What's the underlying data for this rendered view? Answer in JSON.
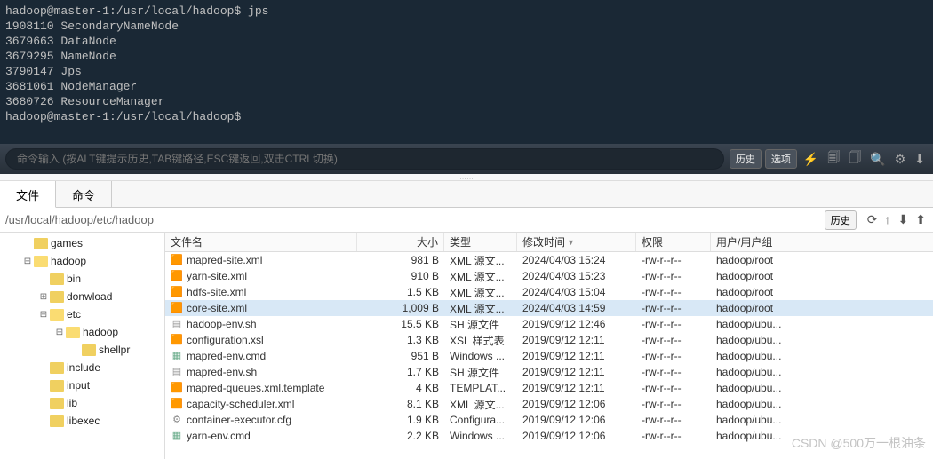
{
  "terminal": {
    "lines": [
      "hadoop@master-1:/usr/local/hadoop$ jps",
      "1908110 SecondaryNameNode",
      "3679663 DataNode",
      "3679295 NameNode",
      "3790147 Jps",
      "3681061 NodeManager",
      "3680726 ResourceManager",
      "hadoop@master-1:/usr/local/hadoop$"
    ]
  },
  "input_bar": {
    "placeholder": "命令输入 (按ALT键提示历史,TAB键路径,ESC键返回,双击CTRL切换)",
    "history_btn": "历史",
    "options_btn": "选项"
  },
  "tabs": {
    "file": "文件",
    "cmd": "命令"
  },
  "path": {
    "value": "/usr/local/hadoop/etc/hadoop",
    "history_btn": "历史"
  },
  "tree": [
    {
      "level": 1,
      "exp": "",
      "open": false,
      "label": "games"
    },
    {
      "level": 1,
      "exp": "⊟",
      "open": true,
      "label": "hadoop"
    },
    {
      "level": 2,
      "exp": "",
      "open": false,
      "label": "bin"
    },
    {
      "level": 2,
      "exp": "⊞",
      "open": false,
      "label": "donwload"
    },
    {
      "level": 2,
      "exp": "⊟",
      "open": true,
      "label": "etc"
    },
    {
      "level": 3,
      "exp": "⊟",
      "open": true,
      "label": "hadoop"
    },
    {
      "level": 4,
      "exp": "",
      "open": false,
      "label": "shellpr"
    },
    {
      "level": 2,
      "exp": "",
      "open": false,
      "label": "include"
    },
    {
      "level": 2,
      "exp": "",
      "open": false,
      "label": "input"
    },
    {
      "level": 2,
      "exp": "",
      "open": false,
      "label": "lib"
    },
    {
      "level": 2,
      "exp": "",
      "open": false,
      "label": "libexec"
    }
  ],
  "columns": {
    "name": "文件名",
    "size": "大小",
    "type": "类型",
    "mtime": "修改时间",
    "perm": "权限",
    "owner": "用户/用户组"
  },
  "files": [
    {
      "icon": "xml",
      "name": "mapred-site.xml",
      "size": "981 B",
      "type": "XML 源文...",
      "mtime": "2024/04/03 15:24",
      "perm": "-rw-r--r--",
      "owner": "hadoop/root",
      "sel": false
    },
    {
      "icon": "xml",
      "name": "yarn-site.xml",
      "size": "910 B",
      "type": "XML 源文...",
      "mtime": "2024/04/03 15:23",
      "perm": "-rw-r--r--",
      "owner": "hadoop/root",
      "sel": false
    },
    {
      "icon": "xml",
      "name": "hdfs-site.xml",
      "size": "1.5 KB",
      "type": "XML 源文...",
      "mtime": "2024/04/03 15:04",
      "perm": "-rw-r--r--",
      "owner": "hadoop/root",
      "sel": false
    },
    {
      "icon": "xml",
      "name": "core-site.xml",
      "size": "1,009 B",
      "type": "XML 源文...",
      "mtime": "2024/04/03 14:59",
      "perm": "-rw-r--r--",
      "owner": "hadoop/root",
      "sel": true
    },
    {
      "icon": "sh",
      "name": "hadoop-env.sh",
      "size": "15.5 KB",
      "type": "SH 源文件",
      "mtime": "2019/09/12 12:46",
      "perm": "-rw-r--r--",
      "owner": "hadoop/ubu...",
      "sel": false
    },
    {
      "icon": "xml",
      "name": "configuration.xsl",
      "size": "1.3 KB",
      "type": "XSL 样式表",
      "mtime": "2019/09/12 12:11",
      "perm": "-rw-r--r--",
      "owner": "hadoop/ubu...",
      "sel": false
    },
    {
      "icon": "cmd",
      "name": "mapred-env.cmd",
      "size": "951 B",
      "type": "Windows ...",
      "mtime": "2019/09/12 12:11",
      "perm": "-rw-r--r--",
      "owner": "hadoop/ubu...",
      "sel": false
    },
    {
      "icon": "sh",
      "name": "mapred-env.sh",
      "size": "1.7 KB",
      "type": "SH 源文件",
      "mtime": "2019/09/12 12:11",
      "perm": "-rw-r--r--",
      "owner": "hadoop/ubu...",
      "sel": false
    },
    {
      "icon": "xml",
      "name": "mapred-queues.xml.template",
      "size": "4 KB",
      "type": "TEMPLAT...",
      "mtime": "2019/09/12 12:11",
      "perm": "-rw-r--r--",
      "owner": "hadoop/ubu...",
      "sel": false
    },
    {
      "icon": "xml",
      "name": "capacity-scheduler.xml",
      "size": "8.1 KB",
      "type": "XML 源文...",
      "mtime": "2019/09/12 12:06",
      "perm": "-rw-r--r--",
      "owner": "hadoop/ubu...",
      "sel": false
    },
    {
      "icon": "cfg",
      "name": "container-executor.cfg",
      "size": "1.9 KB",
      "type": "Configura...",
      "mtime": "2019/09/12 12:06",
      "perm": "-rw-r--r--",
      "owner": "hadoop/ubu...",
      "sel": false
    },
    {
      "icon": "cmd",
      "name": "yarn-env.cmd",
      "size": "2.2 KB",
      "type": "Windows ...",
      "mtime": "2019/09/12 12:06",
      "perm": "-rw-r--r--",
      "owner": "hadoop/ubu...",
      "sel": false
    }
  ],
  "watermark": "CSDN @500万一根油条"
}
